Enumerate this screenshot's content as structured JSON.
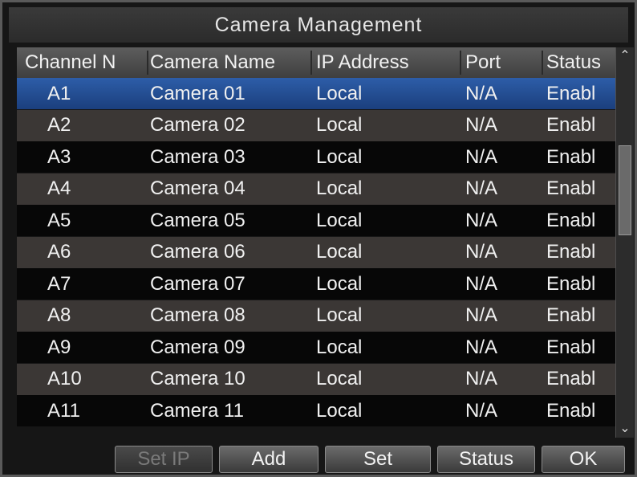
{
  "window": {
    "title": "Camera Management"
  },
  "table": {
    "columns": [
      "Channel N",
      "Camera Name",
      "IP Address",
      "Port",
      "Status"
    ],
    "rows": [
      {
        "channel": "A1",
        "name": "Camera 01",
        "ip": "Local",
        "port": "N/A",
        "status": "Enabl"
      },
      {
        "channel": "A2",
        "name": "Camera 02",
        "ip": "Local",
        "port": "N/A",
        "status": "Enabl"
      },
      {
        "channel": "A3",
        "name": "Camera 03",
        "ip": "Local",
        "port": "N/A",
        "status": "Enabl"
      },
      {
        "channel": "A4",
        "name": "Camera 04",
        "ip": "Local",
        "port": "N/A",
        "status": "Enabl"
      },
      {
        "channel": "A5",
        "name": "Camera 05",
        "ip": "Local",
        "port": "N/A",
        "status": "Enabl"
      },
      {
        "channel": "A6",
        "name": "Camera 06",
        "ip": "Local",
        "port": "N/A",
        "status": "Enabl"
      },
      {
        "channel": "A7",
        "name": "Camera 07",
        "ip": "Local",
        "port": "N/A",
        "status": "Enabl"
      },
      {
        "channel": "A8",
        "name": "Camera 08",
        "ip": "Local",
        "port": "N/A",
        "status": "Enabl"
      },
      {
        "channel": "A9",
        "name": "Camera 09",
        "ip": "Local",
        "port": "N/A",
        "status": "Enabl"
      },
      {
        "channel": "A10",
        "name": "Camera 10",
        "ip": "Local",
        "port": "N/A",
        "status": "Enabl"
      },
      {
        "channel": "A11",
        "name": "Camera 11",
        "ip": "Local",
        "port": "N/A",
        "status": "Enabl"
      }
    ],
    "selected_index": 0
  },
  "scrollbar": {
    "up_icon": "chevron-up-icon",
    "down_icon": "chevron-down-icon"
  },
  "buttons": {
    "set_ip": "Set IP",
    "add": "Add",
    "set": "Set",
    "status": "Status",
    "ok": "OK"
  },
  "colors": {
    "selection": "#2d5da8",
    "row_alt": "#3b3735",
    "row_dark": "#070707"
  }
}
